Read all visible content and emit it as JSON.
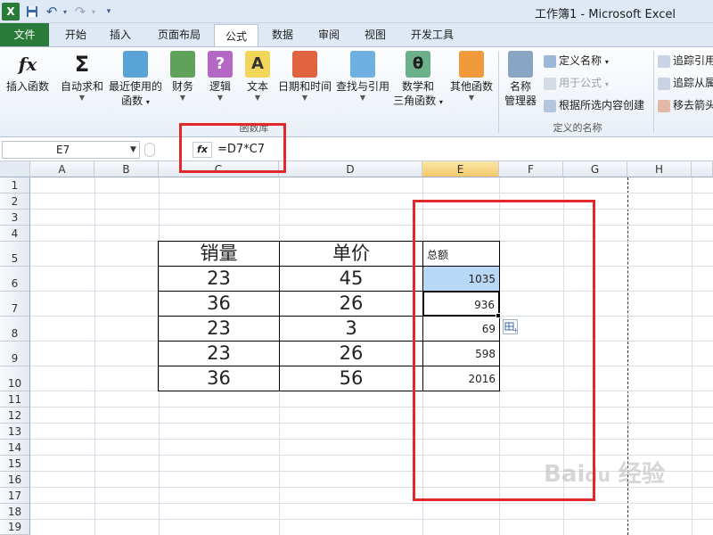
{
  "window": {
    "title": "工作簿1 - Microsoft Excel"
  },
  "quick_access": {
    "excel_logo": "X",
    "undo": "↶",
    "redo": "↷"
  },
  "tabs": [
    {
      "label": "文件"
    },
    {
      "label": "开始"
    },
    {
      "label": "插入"
    },
    {
      "label": "页面布局"
    },
    {
      "label": "公式"
    },
    {
      "label": "数据"
    },
    {
      "label": "审阅"
    },
    {
      "label": "视图"
    },
    {
      "label": "开发工具"
    }
  ],
  "ribbon": {
    "insert_function": {
      "label": "插入函数",
      "icon": "fx"
    },
    "autosum": {
      "label": "自动求和",
      "icon": "Σ"
    },
    "recent": {
      "label1": "最近使用的",
      "label2": "函数"
    },
    "financial": {
      "label": "财务"
    },
    "logical": {
      "label": "逻辑",
      "icon": "?"
    },
    "text": {
      "label": "文本",
      "icon": "A"
    },
    "datetime": {
      "label": "日期和时间"
    },
    "lookup": {
      "label": "查找与引用"
    },
    "math": {
      "label1": "数学和",
      "label2": "三角函数",
      "icon": "θ"
    },
    "other": {
      "label": "其他函数"
    },
    "group_library": "函数库",
    "name_manager": {
      "label1": "名称",
      "label2": "管理器"
    },
    "define_name": "定义名称",
    "use_in_formula": "用于公式",
    "create_from_selection": "根据所选内容创建",
    "group_names": "定义的名称",
    "trace_precedents": "追踪引用",
    "trace_dependents": "追踪从属",
    "remove_arrows": "移去箭头"
  },
  "formula_bar": {
    "name_box": "E7",
    "fx": "fx",
    "formula": "=D7*C7"
  },
  "grid": {
    "columns": [
      "A",
      "B",
      "C",
      "D",
      "E",
      "F",
      "G",
      "H"
    ],
    "rows": [
      "1",
      "2",
      "3",
      "4",
      "5",
      "6",
      "7",
      "8",
      "9",
      "10",
      "11",
      "12",
      "13",
      "14",
      "15",
      "16",
      "17",
      "18",
      "19"
    ]
  },
  "table": {
    "headers": [
      "销量",
      "单价",
      "总额"
    ],
    "rows": [
      {
        "qty": "23",
        "price": "45",
        "total": "1035"
      },
      {
        "qty": "36",
        "price": "26",
        "total": "936"
      },
      {
        "qty": "23",
        "price": "3",
        "total": "69"
      },
      {
        "qty": "23",
        "price": "26",
        "total": "598"
      },
      {
        "qty": "36",
        "price": "56",
        "total": "2016"
      }
    ]
  },
  "colors": {
    "file_tab": "#2a7a3a",
    "selected_cell": "#b9d8f5",
    "annotation": "#e2282a"
  }
}
